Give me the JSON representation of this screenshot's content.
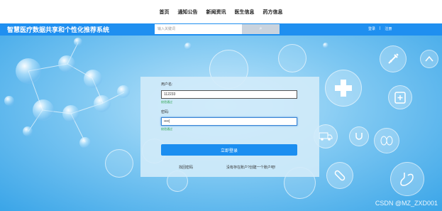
{
  "topnav": {
    "items": [
      "首页",
      "通知公告",
      "新闻资讯",
      "医生信息",
      "药方信息"
    ]
  },
  "header": {
    "site_title": "智慧医疗数据共享和个性化推荐系统",
    "search_placeholder": "输入关键词",
    "search_button_glyph": "⌕",
    "login_label": "登录",
    "separator": "|",
    "register_label": "注册"
  },
  "login_form": {
    "username_label": "用户名:",
    "username_value": "112233",
    "username_hint": "校验通过",
    "password_label": "密码:",
    "password_value": "••••|",
    "password_hint": "校验通过",
    "submit_label": "立即登录",
    "forgot_label": "找回密码",
    "register_prompt": "没有存在账户?创建一个账户吧!"
  },
  "watermark": "CSDN @MZ_ZXD001",
  "colors": {
    "header_bg": "#1f8ff0",
    "button_bg": "#1b8ef0",
    "hint_text": "#2aa24a",
    "hero_bg": "#7fc8f2"
  },
  "decor_icons": [
    "medical-cross-icon",
    "syringe-icon",
    "clipboard-icon",
    "ambulance-icon",
    "pill-icon",
    "kidneys-icon",
    "stomach-icon",
    "hands-icon"
  ]
}
